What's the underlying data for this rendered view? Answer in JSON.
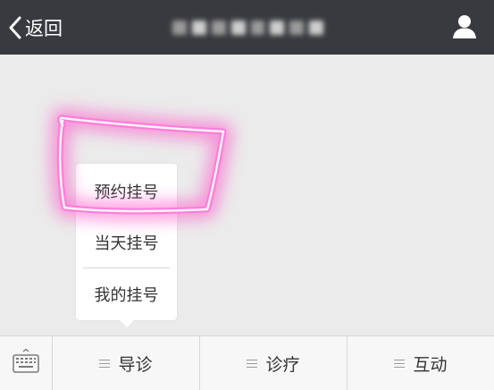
{
  "navbar": {
    "back_label": "返回",
    "title": "",
    "profile_icon": "user-icon"
  },
  "popup_menu": {
    "items": [
      {
        "label": "预约挂号"
      },
      {
        "label": "当天挂号"
      },
      {
        "label": "我的挂号"
      }
    ]
  },
  "bottom_bar": {
    "keyboard_icon": "keyboard-icon",
    "tabs": [
      {
        "label": "导诊"
      },
      {
        "label": "诊疗"
      },
      {
        "label": "互动"
      }
    ]
  },
  "colors": {
    "navbar_bg": "#393a3f",
    "content_bg": "#ebebeb",
    "highlight": "#ff5fd0"
  }
}
